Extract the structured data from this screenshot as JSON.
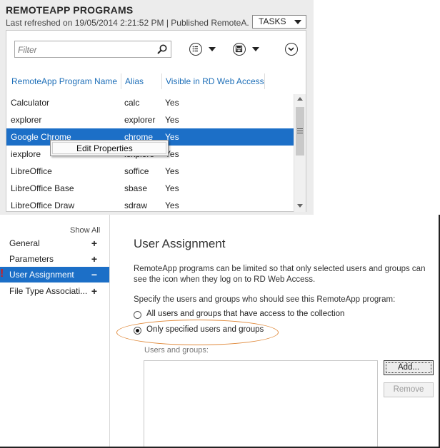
{
  "panel": {
    "title": "REMOTEAPP PROGRAMS",
    "subtitle": "Last refreshed on 19/05/2014 2:21:52 PM | Published RemoteA...",
    "tasks_label": "TASKS",
    "filter_placeholder": "Filter",
    "columns": [
      "RemoteApp Program Name",
      "Alias",
      "Visible in RD Web Access"
    ],
    "rows": [
      {
        "name": "Calculator",
        "alias": "calc",
        "visible": "Yes"
      },
      {
        "name": "explorer",
        "alias": "explorer",
        "visible": "Yes"
      },
      {
        "name": "Google Chrome",
        "alias": "chrome",
        "visible": "Yes"
      },
      {
        "name": "iexplore",
        "alias": "iexplore",
        "visible": "Yes"
      },
      {
        "name": "LibreOffice",
        "alias": "soffice",
        "visible": "Yes"
      },
      {
        "name": "LibreOffice Base",
        "alias": "sbase",
        "visible": "Yes"
      },
      {
        "name": "LibreOffice Draw",
        "alias": "sdraw",
        "visible": "Yes"
      }
    ],
    "selected_row": 2,
    "context_menu": [
      "Edit Properties"
    ],
    "accent_color": "#1c6fc7"
  },
  "dialog": {
    "show_all": "Show All",
    "nav": [
      {
        "label": "General",
        "sign": "+"
      },
      {
        "label": "Parameters",
        "sign": "+"
      },
      {
        "label": "User Assignment",
        "sign": "−"
      },
      {
        "label": "File Type Associati...",
        "sign": "+"
      }
    ],
    "active_nav": 2,
    "warning_mark": "!",
    "section_title": "User Assignment",
    "description": "RemoteApp programs can be limited so that only selected users and groups can see the icon when they log on to RD Web Access.",
    "prompt": "Specify the users and groups who should see this RemoteApp program:",
    "radio_options": [
      {
        "label": "All users and groups that have access to the collection",
        "checked": false
      },
      {
        "label": "Only specified users and groups",
        "checked": true
      }
    ],
    "users_groups_label": "Users and groups:",
    "add_label": "Add...",
    "remove_label": "Remove",
    "highlight_color": "#e08a3c"
  }
}
